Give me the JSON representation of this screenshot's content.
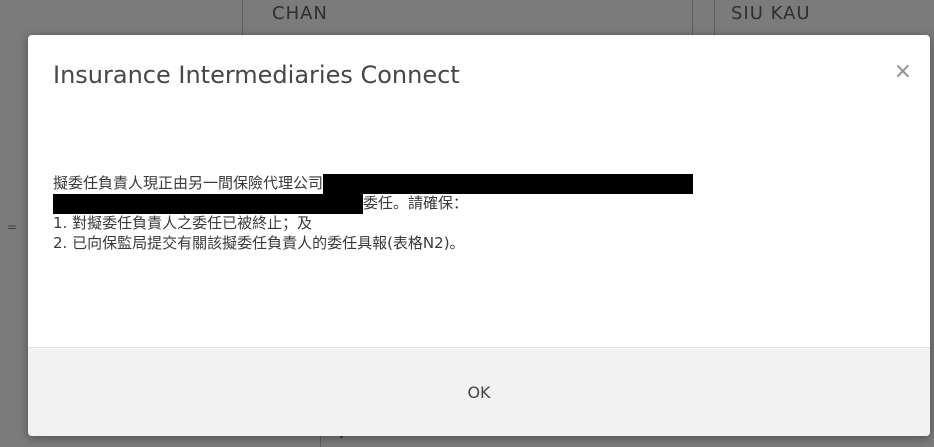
{
  "background": {
    "cells": [
      "CHAN",
      "SIU KAU"
    ],
    "left_marker": "="
  },
  "dialog": {
    "title": "Insurance Intermediaries Connect",
    "close_glyph": "×",
    "body": {
      "line1": "擬委任負責人現正由另一間保險代理公司",
      "line2": "委任。請確保：",
      "line3": "1. 對擬委任負責人之委任已被終止；及",
      "line4": "2. 已向保監局提交有關該擬委任負責人的委任具報(表格N2)。"
    },
    "ok_label": "OK"
  }
}
